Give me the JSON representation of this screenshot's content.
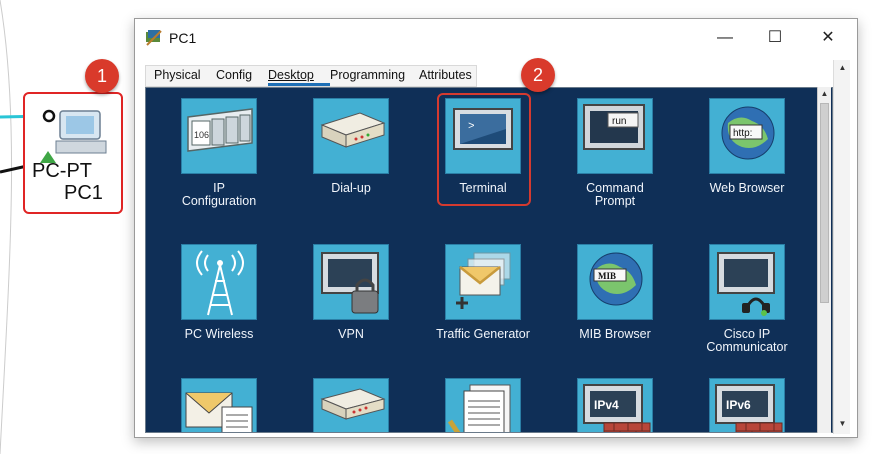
{
  "annotations": {
    "badge_1": "1",
    "badge_2": "2",
    "highlight_color": "#d43a2f"
  },
  "workspace": {
    "device": {
      "type": "PC-PT",
      "name": "PC1"
    }
  },
  "window": {
    "title": "PC1",
    "controls": {
      "minimize": "—",
      "maximize": "☐",
      "close": "✕"
    },
    "tabs": [
      {
        "label": "Physical",
        "active": false
      },
      {
        "label": "Config",
        "active": false
      },
      {
        "label": "Desktop",
        "active": true
      },
      {
        "label": "Programming",
        "active": false
      },
      {
        "label": "Attributes",
        "active": false
      }
    ]
  },
  "desktop": {
    "background_color": "#0f2f57",
    "apps_row1": [
      {
        "label": "IP\nConfiguration",
        "icon": "ip-configuration-icon",
        "tile_text": "106"
      },
      {
        "label": "Dial-up",
        "icon": "modem-icon"
      },
      {
        "label": "Terminal",
        "icon": "terminal-icon",
        "tile_text": ">"
      },
      {
        "label": "Command\nPrompt",
        "icon": "command-prompt-icon",
        "tile_text": "run"
      },
      {
        "label": "Web Browser",
        "icon": "web-browser-icon",
        "tile_text": "http:"
      }
    ],
    "apps_row2": [
      {
        "label": "PC Wireless",
        "icon": "wireless-antenna-icon"
      },
      {
        "label": "VPN",
        "icon": "vpn-lock-icon"
      },
      {
        "label": "Traffic Generator",
        "icon": "traffic-generator-icon"
      },
      {
        "label": "MIB Browser",
        "icon": "mib-browser-icon",
        "tile_text": "MIB"
      },
      {
        "label": "Cisco IP Communicator",
        "icon": "ip-communicator-icon"
      }
    ],
    "apps_row3": [
      {
        "label": "",
        "icon": "email-icon"
      },
      {
        "label": "",
        "icon": "network-device-icon"
      },
      {
        "label": "",
        "icon": "text-editor-icon"
      },
      {
        "label": "",
        "icon": "ipv4-firewall-icon",
        "tile_text": "IPv4"
      },
      {
        "label": "",
        "icon": "ipv6-firewall-icon",
        "tile_text": "IPv6"
      }
    ]
  }
}
